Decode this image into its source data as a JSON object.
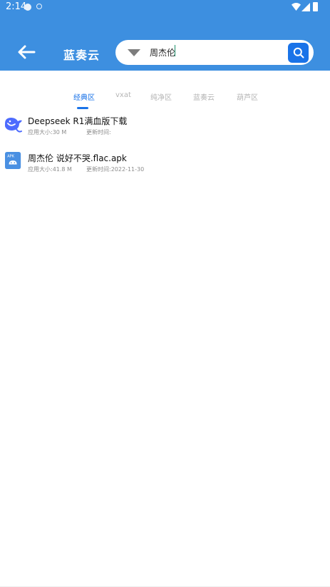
{
  "status_bar": {
    "time": "2:14"
  },
  "header": {
    "title": "蓝奏云",
    "back_icon": "back-arrow-icon"
  },
  "search": {
    "value": "周杰伦",
    "dropdown_icon": "chevron-down-icon",
    "button_icon": "search-icon"
  },
  "tabs": [
    {
      "label": "经典区",
      "active": true
    },
    {
      "label": "vxat",
      "active": false
    },
    {
      "label": "纯净区",
      "active": false
    },
    {
      "label": "蓝奏云",
      "active": false
    },
    {
      "label": "葫芦区",
      "active": false
    }
  ],
  "items": [
    {
      "icon": "deepseek-whale-icon",
      "title": "Deepseek R1满血版下载",
      "size": "应用大小:30 M",
      "time": "更新时间:"
    },
    {
      "icon": "apk-android-icon",
      "title": "周杰伦  说好不哭.flac.apk",
      "size": "应用大小:41.8 M",
      "time": "更新时间:2022-11-30"
    }
  ],
  "colors": {
    "primary": "#3d8fe0",
    "accent": "#1a73e8"
  }
}
